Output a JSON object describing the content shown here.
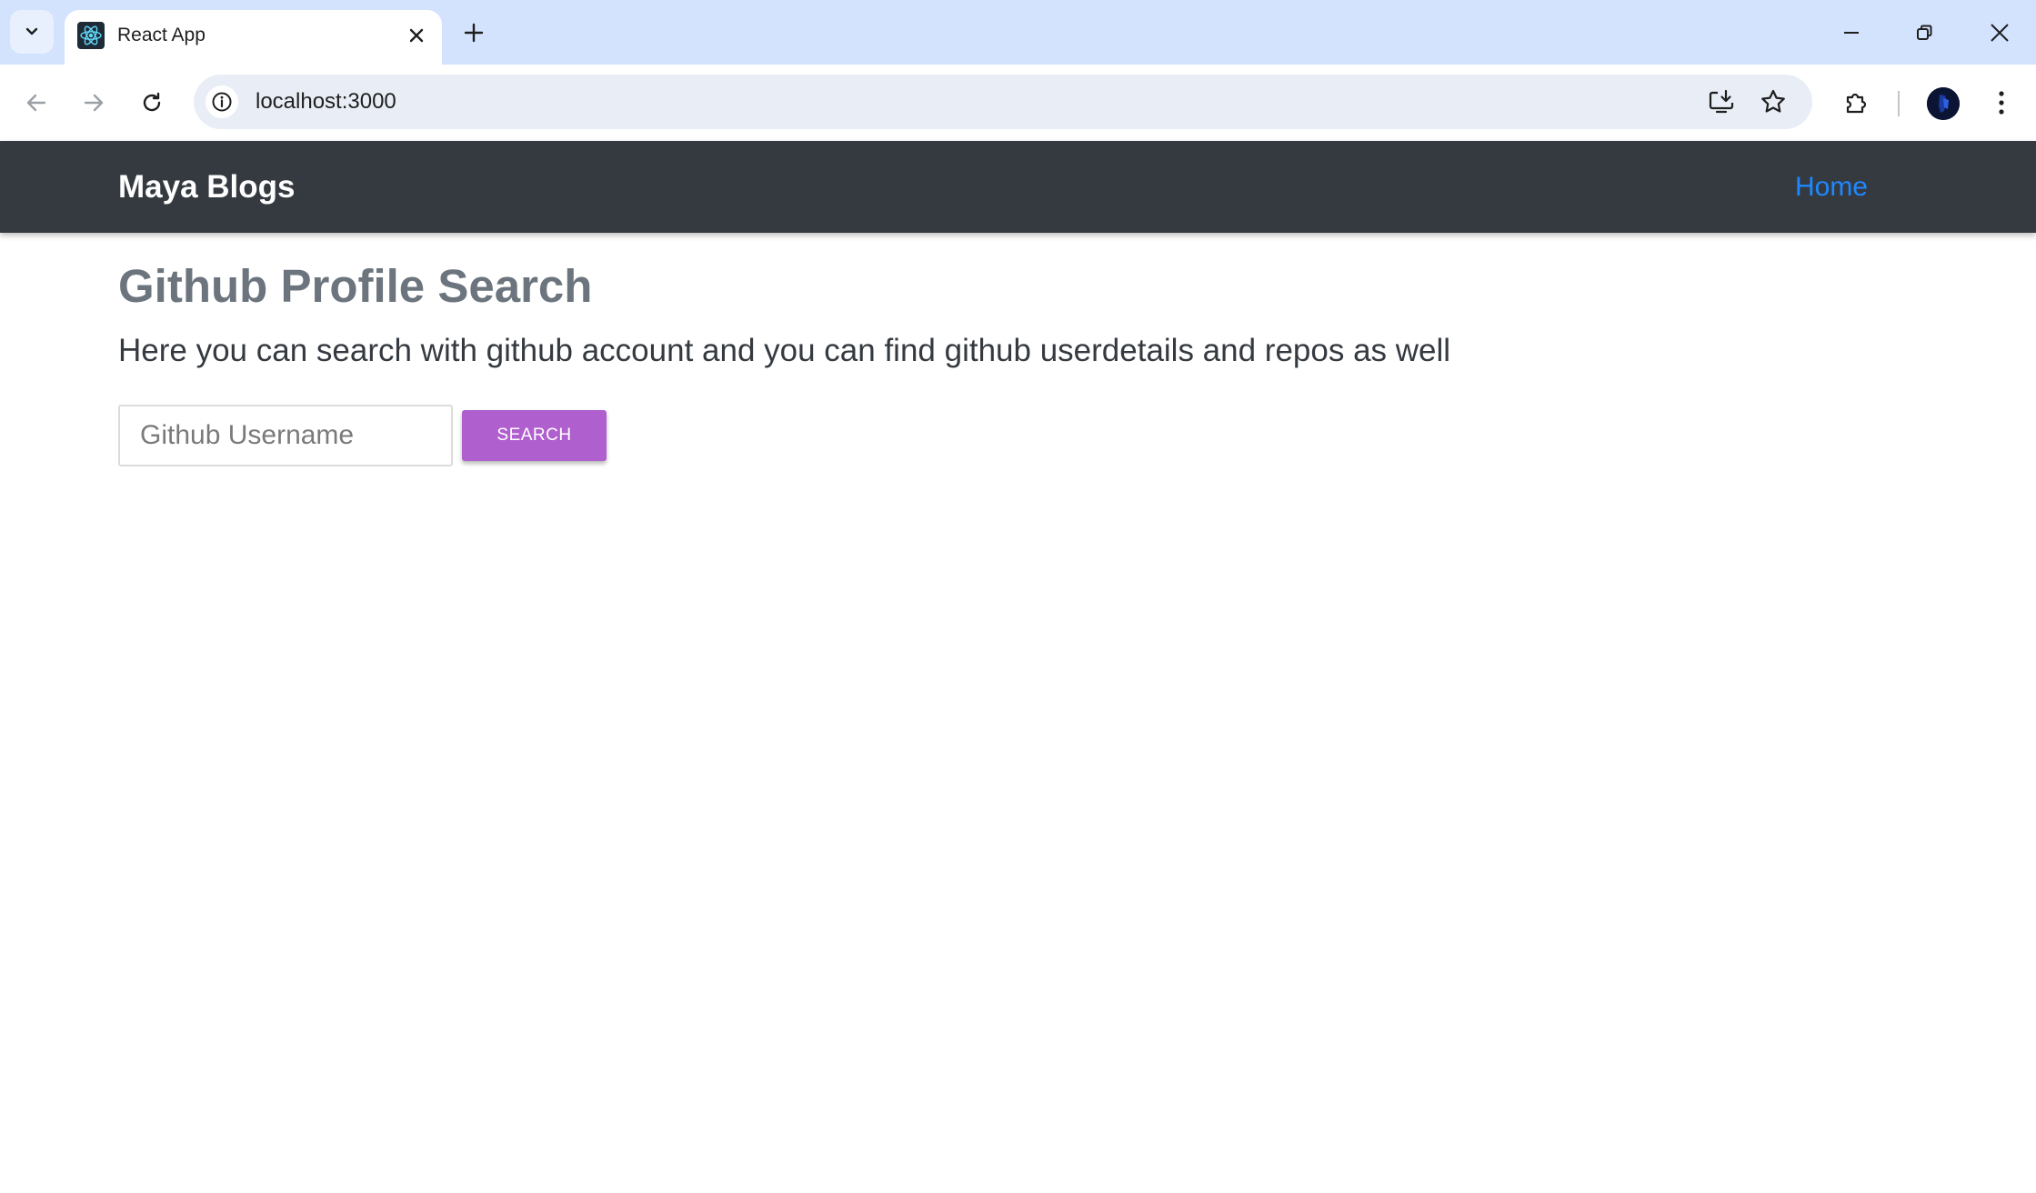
{
  "browser": {
    "tab": {
      "title": "React App",
      "favicon": "react-logo-icon"
    },
    "new_tab_icon": "plus-icon",
    "address_bar": {
      "url": "localhost:3000"
    },
    "icons": {
      "tab_search": "chevron-down-icon",
      "back": "arrow-left-icon",
      "forward": "arrow-right-icon",
      "reload": "reload-icon",
      "site_info": "info-icon",
      "install": "install-app-icon",
      "bookmark": "star-icon",
      "extensions": "puzzle-icon",
      "menu": "more-vertical-icon",
      "minimize": "minimize-icon",
      "restore": "restore-icon",
      "close": "close-icon"
    },
    "colors": {
      "tabstrip": "#d3e3fd",
      "omnibox": "#e9eef6"
    }
  },
  "navbar": {
    "brand": "Maya Blogs",
    "links": [
      {
        "label": "Home"
      }
    ],
    "colors": {
      "background": "#343a40",
      "link": "#1e88ff"
    }
  },
  "main": {
    "title": "Github Profile Search",
    "lead": "Here you can search with github account and you can find github userdetails and repos as well",
    "search": {
      "placeholder": "Github Username",
      "value": "",
      "button_label": "SEARCH",
      "button_color": "#b05fcf"
    }
  }
}
